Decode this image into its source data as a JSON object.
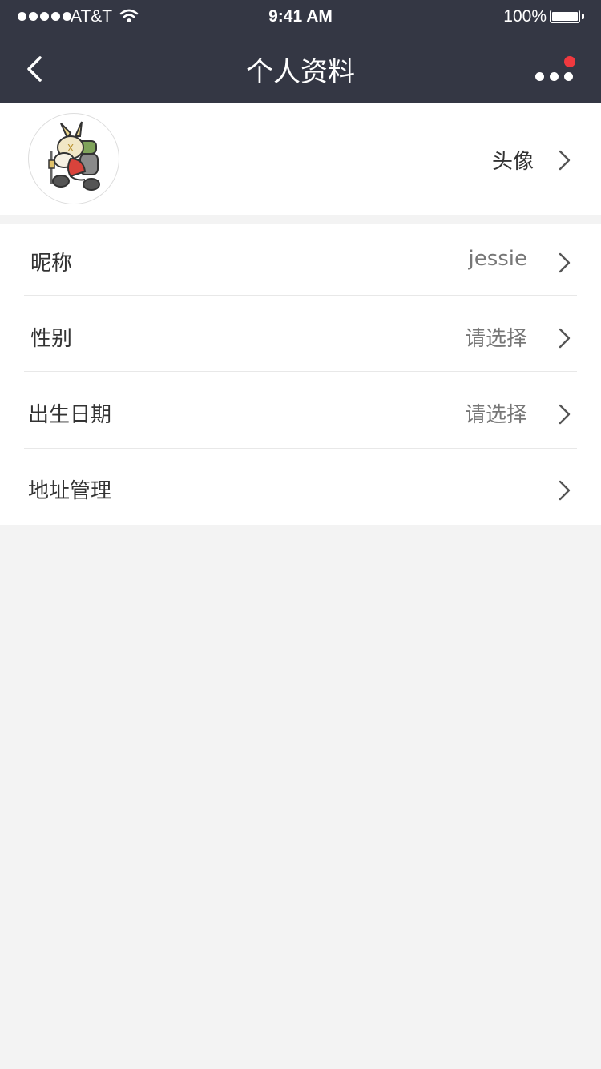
{
  "status_bar": {
    "carrier": "AT&T",
    "time": "9:41 AM",
    "battery": "100%"
  },
  "nav": {
    "title": "个人资料",
    "back_icon": "chevron-left-icon",
    "more_icon": "more-dots-icon",
    "badge_color": "#f0393f"
  },
  "avatar_row": {
    "label": "头像"
  },
  "list": {
    "items": [
      {
        "label": "昵称",
        "value": "jessie"
      },
      {
        "label": "性别",
        "value": "请选择"
      },
      {
        "label": "出生日期",
        "value": "请选择"
      },
      {
        "label": "地址管理",
        "value": ""
      }
    ]
  },
  "colors": {
    "header_bg": "#343744",
    "page_bg": "#f3f3f3"
  }
}
